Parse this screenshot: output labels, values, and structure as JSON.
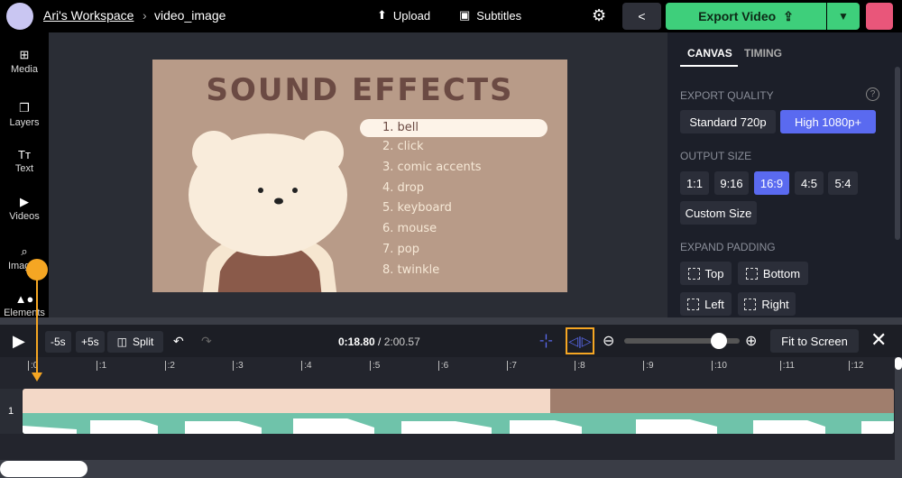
{
  "header": {
    "workspace": "Ari's Workspace",
    "separator": "›",
    "project": "video_image",
    "upload": "Upload",
    "subtitles": "Subtitles",
    "export": "Export Video"
  },
  "sidebar": {
    "items": [
      {
        "label": "Media"
      },
      {
        "label": "Layers"
      },
      {
        "label": "Text",
        "icon": "Tт"
      },
      {
        "label": "Videos"
      },
      {
        "label": "Images"
      },
      {
        "label": "Elements"
      }
    ]
  },
  "video": {
    "title": "SOUND EFFECTS",
    "items": [
      "1. bell",
      "2. click",
      "3. comic accents",
      "4. drop",
      "5. keyboard",
      "6. mouse",
      "7. pop",
      "8. twinkle"
    ]
  },
  "panel": {
    "tabs": [
      "CANVAS",
      "TIMING"
    ],
    "export_quality": "EXPORT QUALITY",
    "help": "?",
    "quality": [
      "Standard 720p",
      "High 1080p+"
    ],
    "output_size": "OUTPUT SIZE",
    "sizes": [
      "1:1",
      "9:16",
      "16:9",
      "4:5",
      "5:4"
    ],
    "custom": "Custom Size",
    "expand_padding": "EXPAND PADDING",
    "padding": [
      "Top",
      "Bottom",
      "Left",
      "Right"
    ]
  },
  "controls": {
    "back5": "-5s",
    "fwd5": "+5s",
    "split": "Split",
    "time_current": "0:18.80",
    "time_sep": " / ",
    "time_total": "2:00.57",
    "fit": "Fit to Screen",
    "zoom_level": 0.82
  },
  "timeline": {
    "ticks": [
      ":0",
      ":1",
      ":2",
      ":3",
      ":4",
      ":5",
      ":6",
      ":7",
      ":8",
      ":9",
      ":10",
      ":11",
      ":12"
    ],
    "track_number": "1"
  },
  "colors": {
    "accent": "#5a6af0",
    "export": "#3ecf7b",
    "highlight": "#f5a623",
    "audio": "#6fc3aa"
  }
}
